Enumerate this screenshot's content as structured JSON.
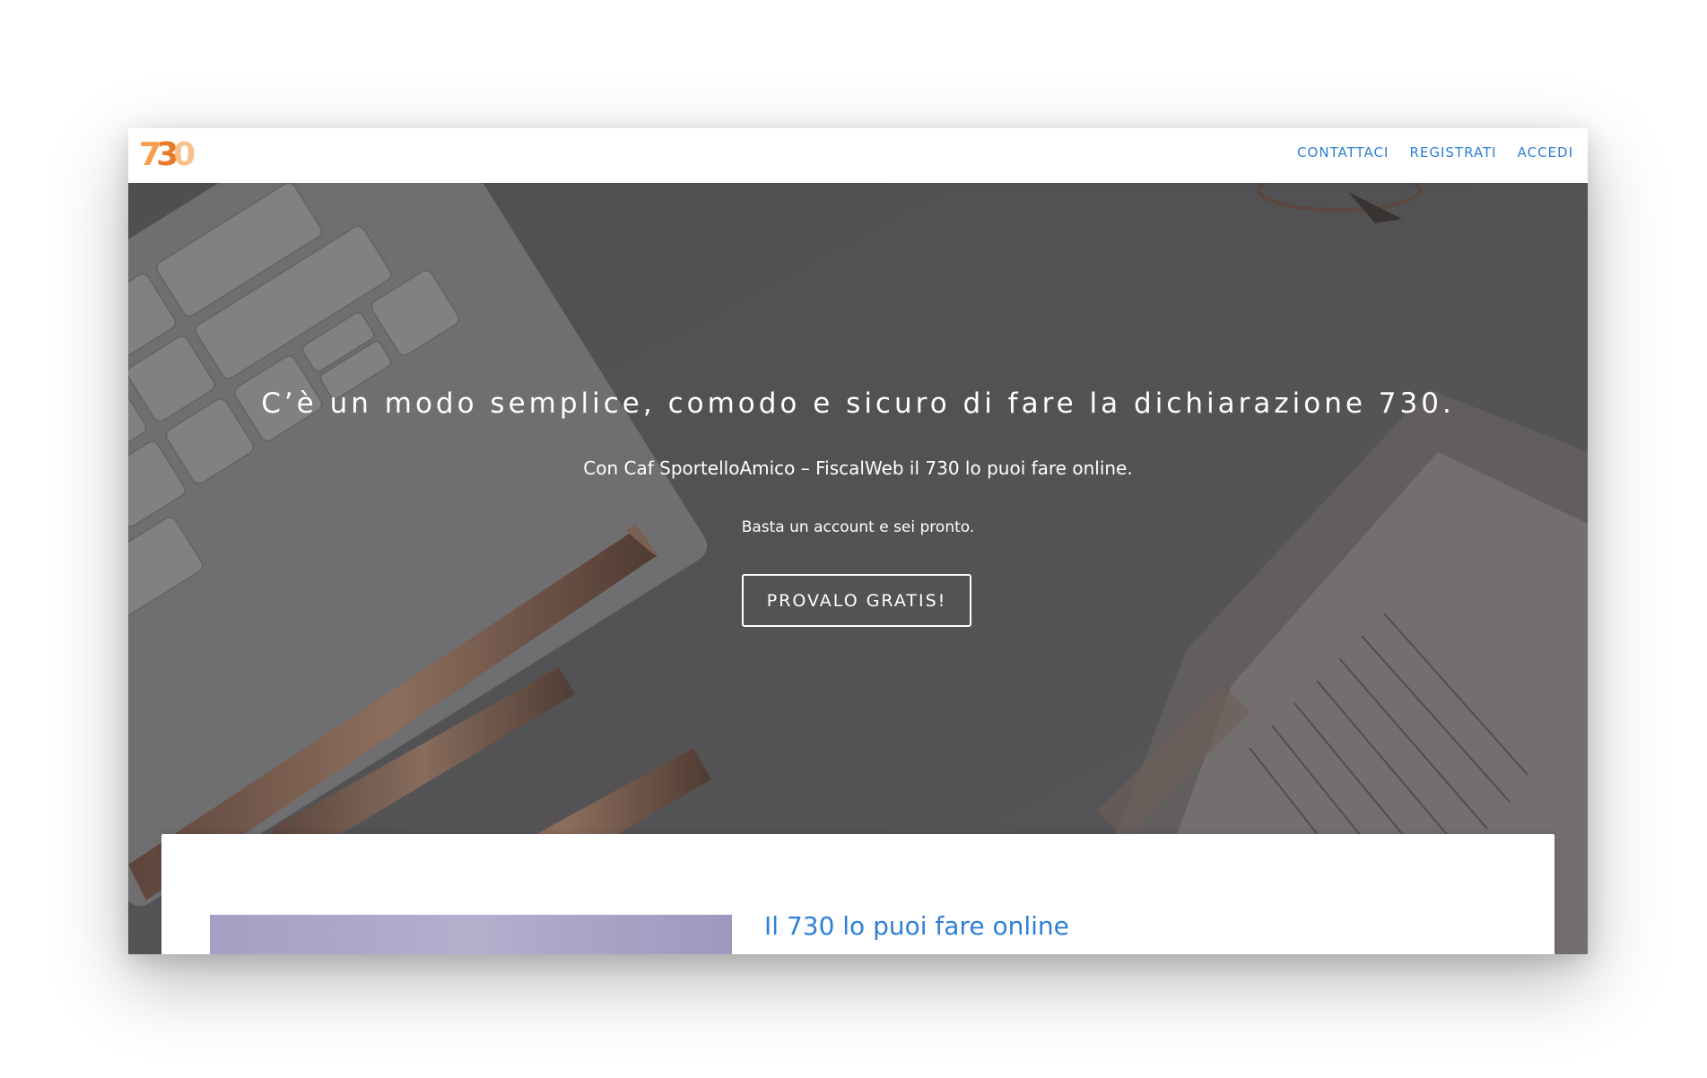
{
  "header": {
    "logo": {
      "d1": "7",
      "d2": "3",
      "d3": "0"
    },
    "nav": {
      "contact": "CONTATTACI",
      "register": "REGISTRATI",
      "login": "ACCEDI"
    }
  },
  "hero": {
    "title": "C’è un modo semplice, comodo e sicuro di fare la dichiarazione 730.",
    "subtitle": "Con Caf SportelloAmico – FiscalWeb il 730 lo puoi fare online.",
    "small": "Basta un account e sei pronto.",
    "cta_label": "PROVALO GRATIS!"
  },
  "section": {
    "title": "Il 730 lo puoi fare online"
  },
  "colors": {
    "link": "#2e7fd8",
    "logo_orange": "#e87b28",
    "hero_overlay": "#5f5f61"
  }
}
